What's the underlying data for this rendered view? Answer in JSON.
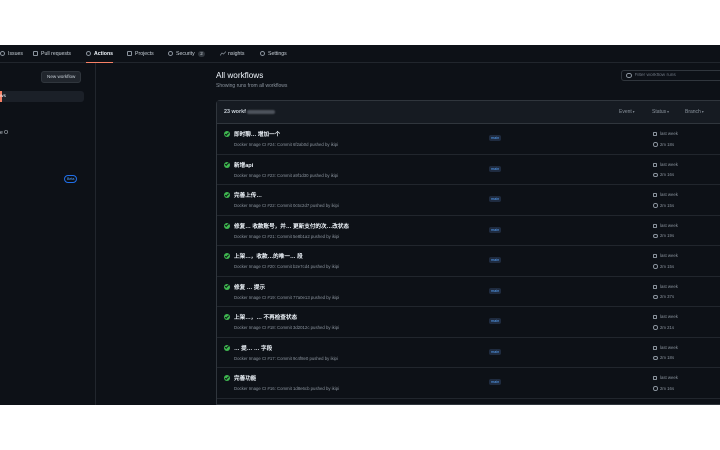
{
  "tabs": [
    {
      "label": "Issues",
      "icon": "issue-icon"
    },
    {
      "label": "Pull requests",
      "icon": "pull-request-icon"
    },
    {
      "label": "Actions",
      "icon": "play-icon",
      "active": true
    },
    {
      "label": "Projects",
      "icon": "table-icon"
    },
    {
      "label": "Security",
      "icon": "shield-icon",
      "count": "2"
    },
    {
      "label": "nsights",
      "icon": "graph-icon"
    },
    {
      "label": "Settings",
      "icon": "gear-icon"
    }
  ],
  "sidebar": {
    "new_workflow": "New workflow",
    "all_workflows_label": "ws",
    "workflow_item": "e O",
    "beta_badge": "Beta"
  },
  "header": {
    "title": "All workflows",
    "subtitle": "Showing runs from all workflows",
    "filter_placeholder": "Filter workflow runs"
  },
  "runs_header": {
    "count_label": "23 workf",
    "filters": [
      "Event",
      "Status",
      "Branch"
    ]
  },
  "runs": [
    {
      "title": "即时聊… 增加一个",
      "subtitle": "Docker Image CI #24: Commit 6f2ab0d pushed by ikipi",
      "branch": "main",
      "when": "last week",
      "duration": "2m 18s"
    },
    {
      "title": "新增api",
      "subtitle": "Docker Image CI #23: Commit a9f1d30 pushed by ikipi",
      "branch": "main",
      "when": "last week",
      "duration": "2m 16s"
    },
    {
      "title": "完善上传…",
      "subtitle": "Docker Image CI #22: Commit 0c5c2d7 pushed by ikipi",
      "branch": "main",
      "when": "last week",
      "duration": "2m 15s"
    },
    {
      "title": "修复… 收款账号，并… 更新支付的次…改状态",
      "subtitle": "Docker Image CI #21: Commit 5e8b1a2 pushed by ikipi",
      "branch": "main",
      "when": "last week",
      "duration": "2m 19s"
    },
    {
      "title": "上架…，收款…的唯一… 段",
      "subtitle": "Docker Image CI #20: Commit b2e7cd4 pushed by ikipi",
      "branch": "main",
      "when": "last week",
      "duration": "2m 15s"
    },
    {
      "title": "修复 … 提示",
      "subtitle": "Docker Image CI #19: Commit 77a0e13 pushed by ikipi",
      "branch": "main",
      "when": "last week",
      "duration": "2m 37s"
    },
    {
      "title": "上架…，… 不再检查状态",
      "subtitle": "Docker Image CI #18: Commit 3d2012c pushed by ikipi",
      "branch": "main",
      "when": "last week",
      "duration": "2m 21s"
    },
    {
      "title": "… 提… … 字段",
      "subtitle": "Docker Image CI #17: Commit 9c4f8e0 pushed by ikipi",
      "branch": "main",
      "when": "last week",
      "duration": "2m 18s"
    },
    {
      "title": "完善功能",
      "subtitle": "Docker Image CI #16: Commit 1d8e6cb pushed by ikipi",
      "branch": "main",
      "when": "last week",
      "duration": "2m 16s"
    }
  ],
  "colors": {
    "accent": "#f78166",
    "success": "#3fb950",
    "link": "#58a6ff",
    "bg": "#0d1117"
  }
}
